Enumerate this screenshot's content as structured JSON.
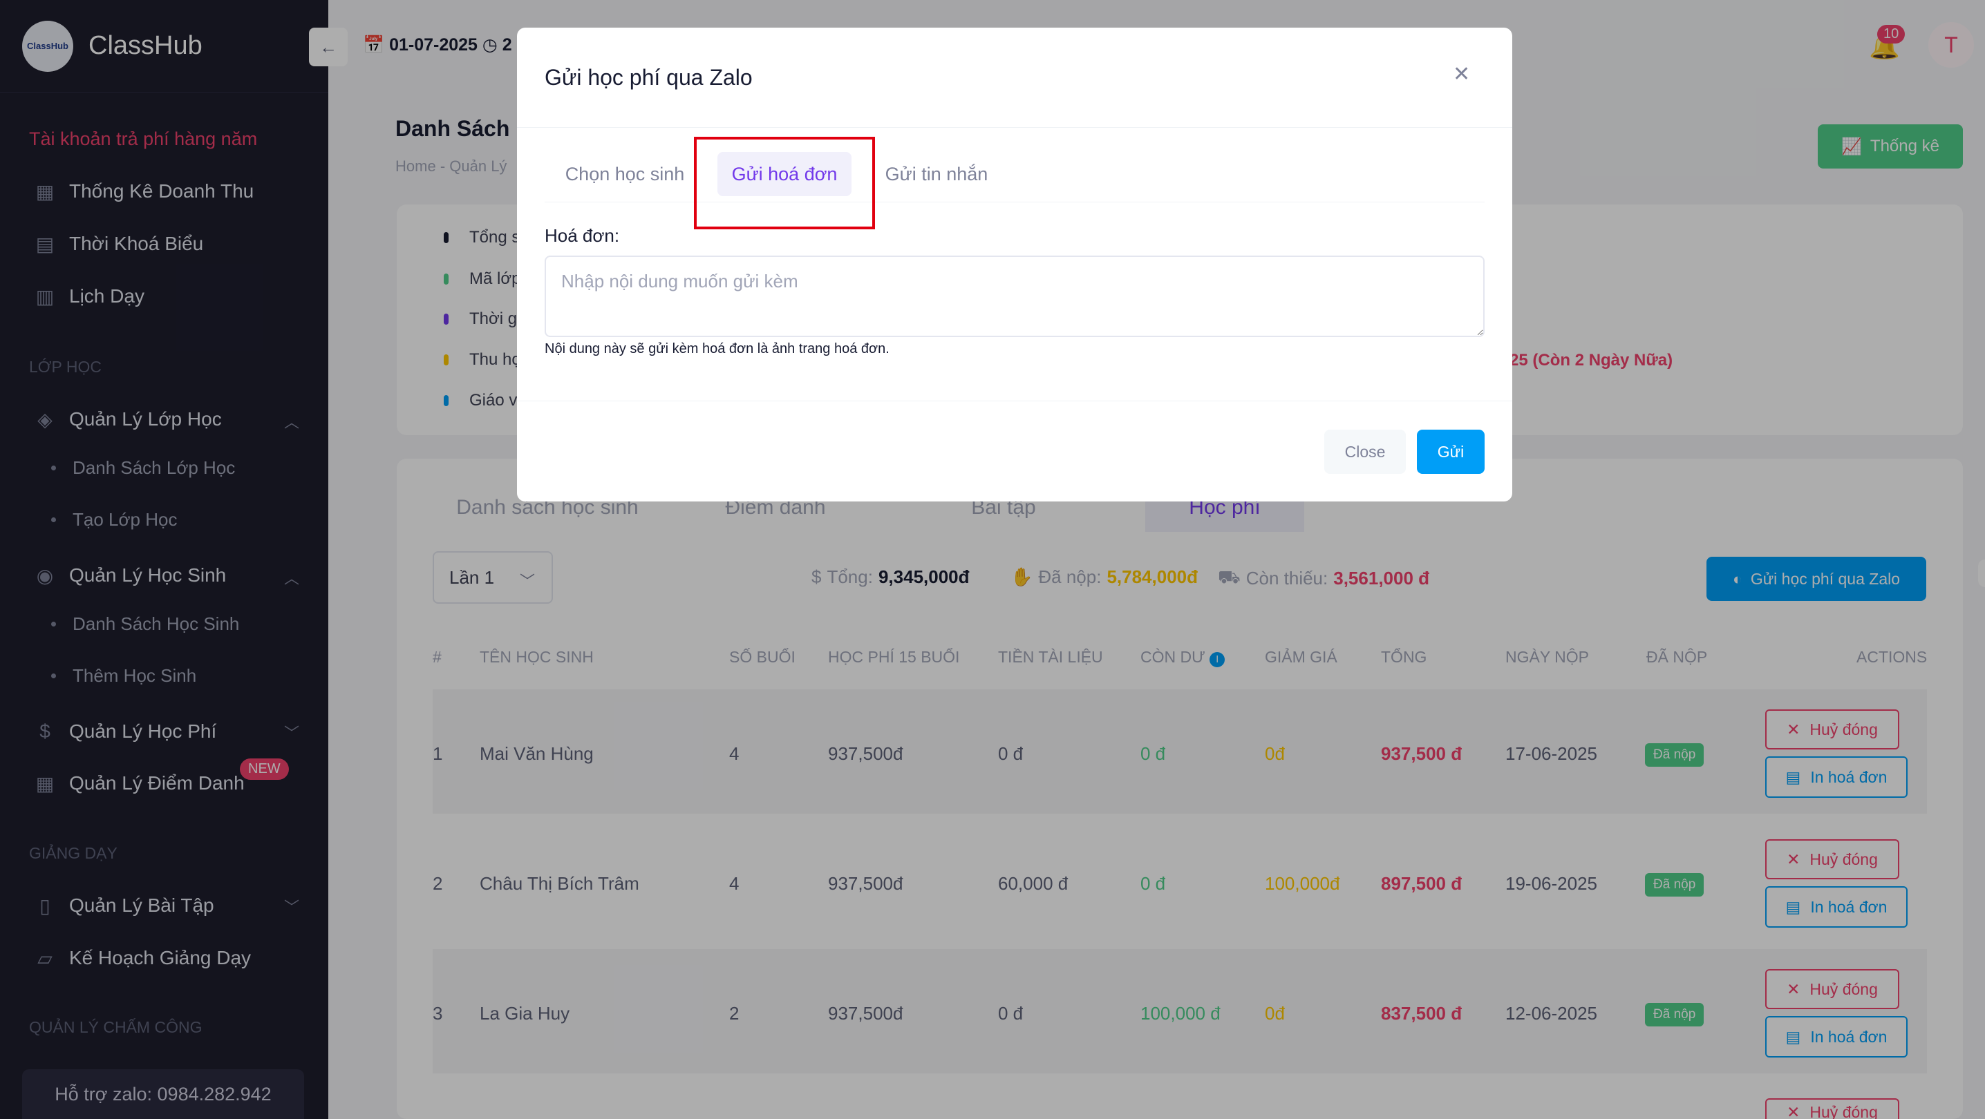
{
  "sidebar": {
    "app_name": "ClassHub",
    "logo_text": "ClassHub",
    "promo": "Tài khoản trả phí hàng năm",
    "top_items": [
      {
        "label": "Thống Kê Doanh Thu",
        "icon": "chart-icon"
      },
      {
        "label": "Thời Khoá Biểu",
        "icon": "calendar-icon"
      },
      {
        "label": "Lịch Dạy",
        "icon": "schedule-icon"
      }
    ],
    "section_class": "LỚP HỌC",
    "class_mgmt": {
      "label": "Quản Lý Lớp Học",
      "subs": [
        "Danh Sách Lớp Học",
        "Tạo Lớp Học"
      ]
    },
    "student_mgmt": {
      "label": "Quản Lý Học Sinh",
      "subs": [
        "Danh Sách Học Sinh",
        "Thêm Học Sinh"
      ]
    },
    "fee_mgmt": {
      "label": "Quản Lý Học Phí"
    },
    "attendance_mgmt": {
      "label": "Quản Lý Điểm Danh",
      "badge": "NEW"
    },
    "section_teaching": "GIẢNG DẠY",
    "homework_mgmt": {
      "label": "Quản Lý Bài Tập"
    },
    "teaching_plan": {
      "label": "Kế Hoạch Giảng Dạy"
    },
    "section_timekeeping": "QUẢN LÝ CHẤM CÔNG",
    "support": "Hỗ trợ zalo: 0984.282.942"
  },
  "topbar": {
    "date": "01-07-2025",
    "time_partial": "2",
    "notification_count": "10",
    "avatar_letter": "T"
  },
  "page": {
    "title": "Danh Sách L",
    "breadcrumb_home": "Home",
    "breadcrumb_sep": "-",
    "breadcrumb_current": "Quản Lý",
    "stats_button": "Thống kê",
    "info_lines": [
      "Tổng s",
      "Mã lớp",
      "Thời g",
      "Thu họ",
      "Giáo v"
    ],
    "info_warning": "25 (Còn 2 Ngày Nữa)",
    "tabs": [
      "Danh sách học sinh",
      "Điểm danh",
      "Bài tập",
      "Học phí"
    ],
    "round_select": "Lần 1",
    "summary": {
      "total_label": "Tổng:",
      "total_value": "9,345,000đ",
      "paid_label": "Đã nộp:",
      "paid_value": "5,784,000đ",
      "owed_label": "Còn thiếu:",
      "owed_value": "3,561,000 đ"
    },
    "zalo_button": "Gửi học phí qua Zalo",
    "table": {
      "headers": [
        "#",
        "TÊN HỌC SINH",
        "SỐ BUỔI",
        "HỌC PHÍ 15 BUỔI",
        "TIỀN TÀI LIỆU",
        "CÒN DƯ",
        "GIẢM GIÁ",
        "TỔNG",
        "NGÀY NỘP",
        "ĐÃ NỘP",
        "ACTIONS"
      ],
      "rows": [
        {
          "no": "1",
          "name": "Mai Văn Hùng",
          "sessions": "4",
          "fee": "937,500đ",
          "material": "0 đ",
          "balance": "0 đ",
          "discount": "0đ",
          "total": "937,500 đ",
          "date": "17-06-2025",
          "status": "Đã nộp"
        },
        {
          "no": "2",
          "name": "Châu Thị Bích Trâm",
          "sessions": "4",
          "fee": "937,500đ",
          "material": "60,000 đ",
          "balance": "0 đ",
          "discount": "100,000đ",
          "total": "897,500 đ",
          "date": "19-06-2025",
          "status": "Đã nộp"
        },
        {
          "no": "3",
          "name": "La Gia Huy",
          "sessions": "2",
          "fee": "937,500đ",
          "material": "0 đ",
          "balance": "100,000 đ",
          "discount": "0đ",
          "total": "837,500 đ",
          "date": "12-06-2025",
          "status": "Đã nộp"
        }
      ],
      "action_cancel": "Huỷ đóng",
      "action_print": "In hoá đơn"
    }
  },
  "modal": {
    "title": "Gửi học phí qua Zalo",
    "tabs": [
      "Chọn học sinh",
      "Gửi hoá đơn",
      "Gửi tin nhắn"
    ],
    "field_label": "Hoá đơn:",
    "placeholder": "Nhập nội dung muốn gửi kèm",
    "hint": "Nội dung này sẽ gửi kèm hoá đơn là ảnh trang hoá đơn.",
    "close_button": "Close",
    "send_button": "Gửi"
  },
  "colors": {
    "sidebar_bg": "#1e1e2d",
    "primary": "#009ef7",
    "purple": "#7239ea",
    "danger": "#f1416c",
    "success": "#50cd89",
    "warning": "#ffc700",
    "highlight": "#e1000f"
  }
}
